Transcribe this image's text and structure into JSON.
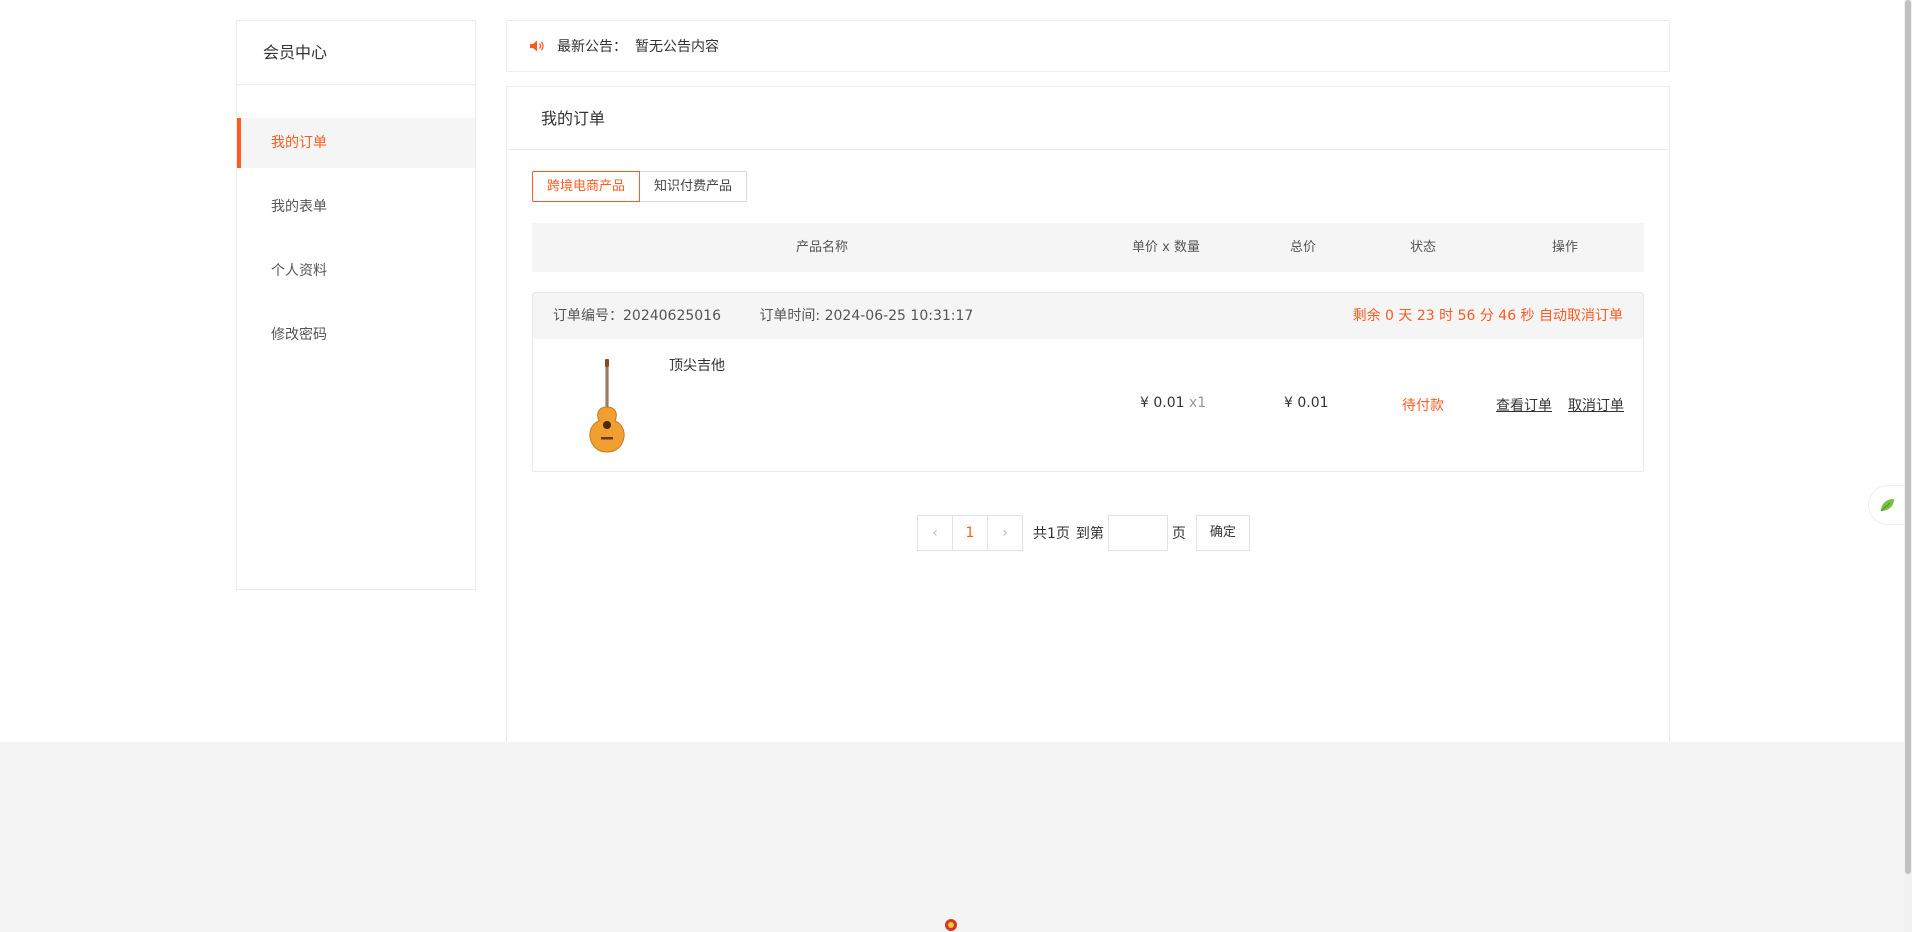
{
  "sidebar": {
    "title": "会员中心",
    "items": [
      {
        "label": "我的订单"
      },
      {
        "label": "我的表单"
      },
      {
        "label": "个人资料"
      },
      {
        "label": "修改密码"
      }
    ]
  },
  "notice": {
    "label": "最新公告：",
    "content": "暂无公告内容"
  },
  "panel": {
    "title": "我的订单",
    "tabs": [
      {
        "label": "跨境电商产品"
      },
      {
        "label": "知识付费产品"
      }
    ],
    "columns": {
      "name": "产品名称",
      "price_qty": "单价 x 数量",
      "total": "总价",
      "status": "状态",
      "ops": "操作"
    },
    "order": {
      "number": "订单编号：20240625016",
      "time": "订单时间: 2024-06-25 10:31:17",
      "countdown": "剩余 0 天 23 时 56 分 46 秒 自动取消订单",
      "product_name": "顶尖吉他",
      "unit_price": "¥ 0.01",
      "qty": "x1",
      "total": "¥ 0.01",
      "status": "待付款",
      "view": "查看订单",
      "cancel": "取消订单"
    }
  },
  "pagination": {
    "current_page": "1",
    "total": "共1页",
    "goto_label": "到第",
    "page_unit": "页",
    "confirm": "确定",
    "prev_icon": "‹",
    "next_icon": "›"
  },
  "colors": {
    "accent": "#ff5a1f",
    "footer": "#f4f4f4"
  }
}
